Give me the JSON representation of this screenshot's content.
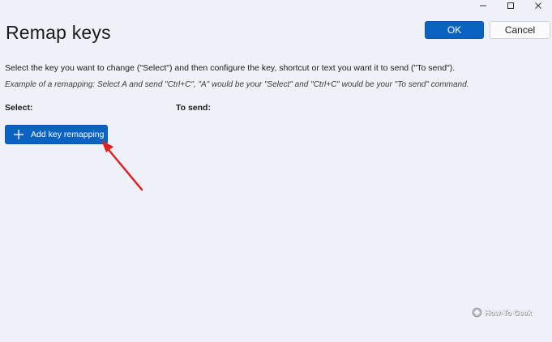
{
  "window": {
    "controls": {
      "minimize_icon": "minimize-icon",
      "maximize_icon": "maximize-icon",
      "close_icon": "close-icon"
    }
  },
  "header": {
    "title": "Remap keys",
    "ok_label": "OK",
    "cancel_label": "Cancel"
  },
  "body": {
    "instruction": "Select the key you want to change (\"Select\") and then configure the key, shortcut or text you want it to send (\"To send\").",
    "example": "Example of a remapping: Select A and send \"Ctrl+C\", \"A\" would be your \"Select\" and \"Ctrl+C\" would be your \"To send\" command.",
    "select_header": "Select:",
    "send_header": "To send:",
    "add_button_label": "Add key remapping"
  },
  "watermark": {
    "text": "How-To Geek"
  },
  "colors": {
    "background": "#eef2f8",
    "accent": "#0a62c2",
    "annotation_arrow": "#e01f1f"
  }
}
